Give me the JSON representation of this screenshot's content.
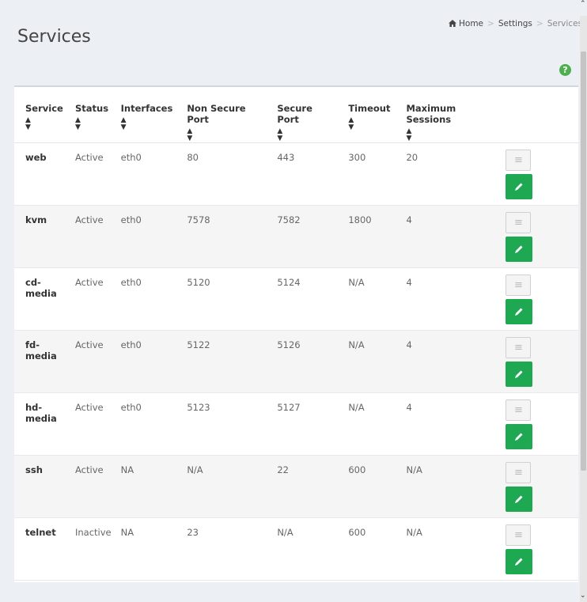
{
  "header": {
    "title": "Services",
    "breadcrumb": {
      "home": "Home",
      "settings": "Settings",
      "current": "Services"
    }
  },
  "table": {
    "columns": [
      {
        "label": "Service"
      },
      {
        "label": "Status"
      },
      {
        "label": "Interfaces"
      },
      {
        "label": "Non Secure Port"
      },
      {
        "label": "Secure Port"
      },
      {
        "label": "Timeout"
      },
      {
        "label": "Maximum Sessions"
      }
    ],
    "rows": [
      {
        "service": "web",
        "status": "Active",
        "interfaces": "eth0",
        "non_secure_port": "80",
        "secure_port": "443",
        "timeout": "300",
        "max_sessions": "20"
      },
      {
        "service": "kvm",
        "status": "Active",
        "interfaces": "eth0",
        "non_secure_port": "7578",
        "secure_port": "7582",
        "timeout": "1800",
        "max_sessions": "4"
      },
      {
        "service": "cd-media",
        "status": "Active",
        "interfaces": "eth0",
        "non_secure_port": "5120",
        "secure_port": "5124",
        "timeout": "N/A",
        "max_sessions": "4"
      },
      {
        "service": "fd-media",
        "status": "Active",
        "interfaces": "eth0",
        "non_secure_port": "5122",
        "secure_port": "5126",
        "timeout": "N/A",
        "max_sessions": "4"
      },
      {
        "service": "hd-media",
        "status": "Active",
        "interfaces": "eth0",
        "non_secure_port": "5123",
        "secure_port": "5127",
        "timeout": "N/A",
        "max_sessions": "4"
      },
      {
        "service": "ssh",
        "status": "Active",
        "interfaces": "NA",
        "non_secure_port": "N/A",
        "secure_port": "22",
        "timeout": "600",
        "max_sessions": "N/A"
      },
      {
        "service": "telnet",
        "status": "Inactive",
        "interfaces": "NA",
        "non_secure_port": "23",
        "secure_port": "N/A",
        "timeout": "600",
        "max_sessions": "N/A"
      }
    ]
  },
  "icons": {
    "home": "home-icon",
    "help": "help-icon",
    "sort": "sort-icon",
    "view": "list-icon",
    "edit": "pencil-icon"
  },
  "colors": {
    "accent_green": "#1da851",
    "help_green": "#4caf50"
  }
}
